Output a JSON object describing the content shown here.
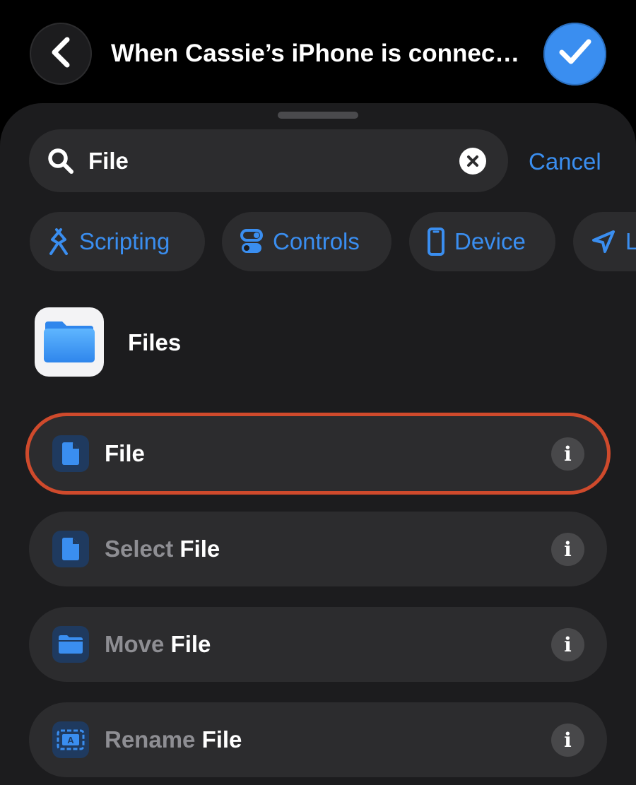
{
  "header": {
    "title": "When Cassie’s iPhone is connec…",
    "back_icon": "chevron-left-icon",
    "done_icon": "checkmark-icon"
  },
  "search": {
    "query": "File",
    "cancel_label": "Cancel"
  },
  "categories": [
    {
      "label": "Scripting",
      "icon": "scripting-icon"
    },
    {
      "label": "Controls",
      "icon": "controls-icon"
    },
    {
      "label": "Device",
      "icon": "device-icon"
    },
    {
      "label": "L",
      "icon": "location-icon"
    }
  ],
  "app_section": {
    "name": "Files",
    "icon": "folder-icon"
  },
  "actions": [
    {
      "prefix": "",
      "match": "File",
      "icon": "document-icon",
      "info": "i"
    },
    {
      "prefix": "Select ",
      "match": "File",
      "icon": "document-icon",
      "info": "i"
    },
    {
      "prefix": "Move ",
      "match": "File",
      "icon": "folder-icon",
      "info": "i"
    },
    {
      "prefix": "Rename ",
      "match": "File",
      "icon": "rename-icon",
      "info": "i"
    }
  ],
  "colors": {
    "accent": "#3a8ef0",
    "highlight": "#cf4a2c",
    "sheet": "#1c1c1e",
    "row": "#2c2c2e"
  }
}
